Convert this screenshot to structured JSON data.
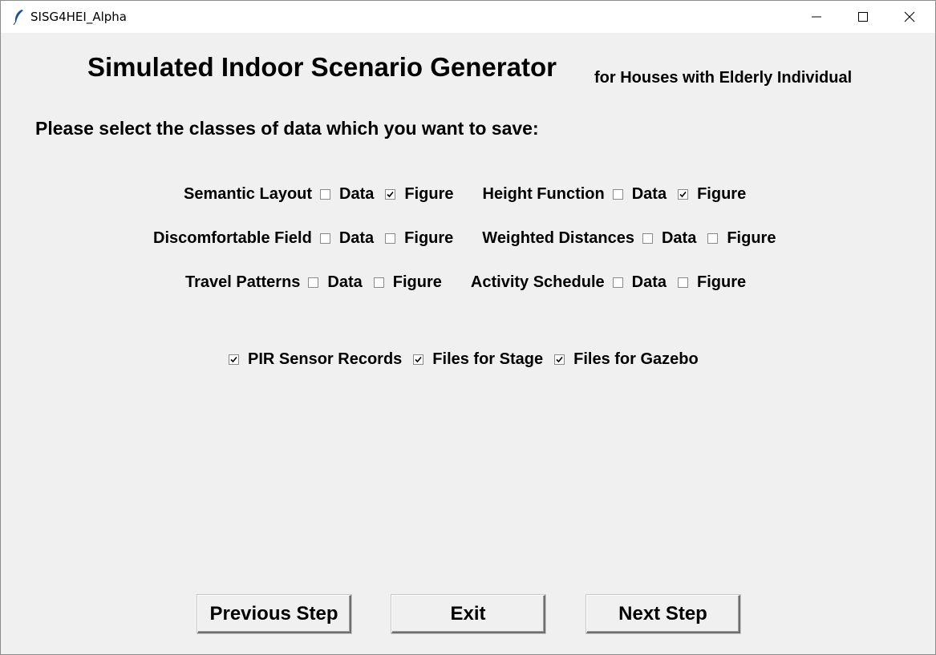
{
  "window": {
    "title": "SISG4HEI_Alpha"
  },
  "header": {
    "title": "Simulated Indoor Scenario Generator",
    "subtitle": "for Houses with Elderly Individual",
    "prompt": "Please select the classes of data which you want to save:"
  },
  "options": {
    "semantic_layout": {
      "label": "Semantic Layout",
      "data_label": "Data",
      "data_checked": false,
      "figure_label": "Figure",
      "figure_checked": true
    },
    "height_function": {
      "label": "Height Function",
      "data_label": "Data",
      "data_checked": false,
      "figure_label": "Figure",
      "figure_checked": true
    },
    "discomfortable_field": {
      "label": "Discomfortable Field",
      "data_label": "Data",
      "data_checked": false,
      "figure_label": "Figure",
      "figure_checked": false
    },
    "weighted_distances": {
      "label": "Weighted Distances",
      "data_label": "Data",
      "data_checked": false,
      "figure_label": "Figure",
      "figure_checked": false
    },
    "travel_patterns": {
      "label": "Travel Patterns",
      "data_label": "Data",
      "data_checked": false,
      "figure_label": "Figure",
      "figure_checked": false
    },
    "activity_schedule": {
      "label": "Activity Schedule",
      "data_label": "Data",
      "data_checked": false,
      "figure_label": "Figure",
      "figure_checked": false
    }
  },
  "extras": {
    "pir": {
      "label": "PIR Sensor Records",
      "checked": true
    },
    "stage": {
      "label": "Files for Stage",
      "checked": true
    },
    "gazebo": {
      "label": "Files for Gazebo",
      "checked": true
    }
  },
  "buttons": {
    "previous": "Previous Step",
    "exit": "Exit",
    "next": "Next Step"
  },
  "colors": {
    "window_bg": "#f0f0f0",
    "titlebar_bg": "#ffffff",
    "text": "#000000"
  }
}
